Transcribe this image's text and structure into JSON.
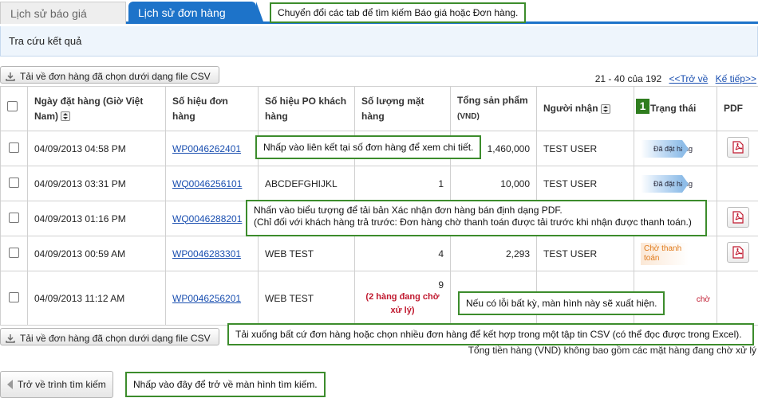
{
  "tabs": {
    "quotes": "Lịch sử báo giá",
    "orders": "Lịch sử đơn hàng"
  },
  "section_title": "Tra cứu kết quả",
  "csv_button_label": "Tải về đơn hàng đã chọn dưới dạng file CSV",
  "pager": {
    "range": "21 - 40 của 192",
    "back": "<<Trở về",
    "next": "Kế tiếp>>"
  },
  "table": {
    "headers": {
      "date": "Ngày đặt hàng (Giờ Việt Nam)",
      "order_no": "Số hiệu đơn hàng",
      "po_no": "Số hiệu PO khách hàng",
      "qty": "Số lượng mặt hàng",
      "total": "Tổng sản phẩm",
      "total_unit": "(VND)",
      "recipient": "Người nhận",
      "status": "Trạng thái",
      "pdf": "PDF"
    },
    "rows": [
      {
        "date": "04/09/2013 04:58 PM",
        "order": "WP0046262401",
        "po": "",
        "qty": "",
        "total": "1,460,000",
        "recipient": "TEST USER",
        "status": "Đã đặt hàng"
      },
      {
        "date": "04/09/2013 03:31 PM",
        "order": "WQ0046256101",
        "po": "ABCDEFGHIJKL",
        "qty": "1",
        "total": "10,000",
        "recipient": "TEST USER",
        "status": "Đã đặt hàng"
      },
      {
        "date": "04/09/2013 01:16 PM",
        "order": "WQ0046288201",
        "po": "",
        "qty": "",
        "total": "",
        "recipient": "",
        "status": ""
      },
      {
        "date": "04/09/2013 00:59 AM",
        "order": "WP0046283301",
        "po": "WEB TEST",
        "qty": "4",
        "total": "2,293",
        "recipient": "TEST USER",
        "status": "Chờ thanh toán"
      },
      {
        "date": "04/09/2013 11:12 AM",
        "order": "WP0046256201",
        "po": "WEB TEST",
        "qty": "9",
        "qty_note": "(2 hàng đang chờ xử lý)",
        "total": "",
        "recipient": "",
        "status": "chờ"
      }
    ]
  },
  "footnote": "Tổng tiền hàng (VND) không bao gồm các mặt hàng đang chờ xử lý",
  "back_button": "Trở về trình tìm kiếm",
  "marker_number": "1",
  "callouts": {
    "tabs": "Chuyển đổi các tab để tìm kiếm Báo giá hoặc Đơn hàng.",
    "order_link": "Nhấp vào liên kết tại số đơn hàng để xem chi tiết.",
    "pdf_line1": "Nhấn vào biểu tượng để tải bản Xác nhận đơn hàng bán định dạng PDF.",
    "pdf_line2": "(Chỉ đối với khách hàng trả trước: Đơn hàng chờ thanh toán được tải trước khi nhận được thanh toán.)",
    "error": "Nếu có lỗi bất kỳ,  màn hình này sẽ xuất hiện.",
    "csv": "Tải xuống bất cứ đơn hàng hoặc chọn nhiều đơn hàng để kết hợp trong một tập tin CSV (có thể đọc được trong Excel).",
    "back": "Nhấp vào đây để trở về màn hình tìm kiếm."
  },
  "colors": {
    "tab_active": "#1d73c9",
    "callout_border": "#3c8c2c",
    "link": "#1a4fb0",
    "warning_red": "#c0182e"
  }
}
